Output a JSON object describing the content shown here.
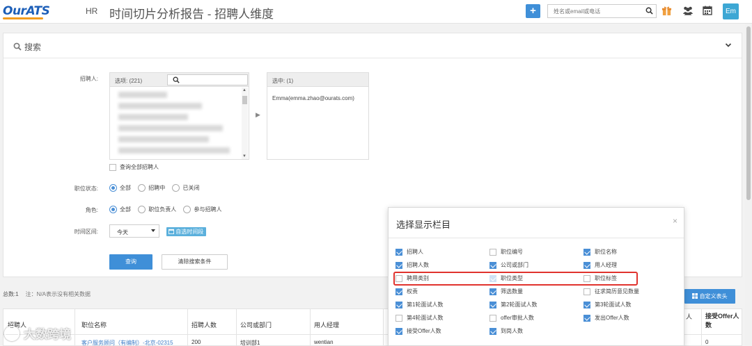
{
  "header": {
    "logo": "OurATS",
    "module": "HR",
    "title": "时间切片分析报告 - 招聘人维度",
    "add_label": "+",
    "search_placeholder": "姓名或email或电话",
    "avatar": "Em"
  },
  "search_panel": {
    "title": "搜索",
    "recruiter_label": "招聘人:",
    "options_header": "选项: (221)",
    "selected_header": "选中: (1)",
    "selected_items": [
      "Emma(emma.zhao@ourats.com)"
    ],
    "all_recruiters_label": "查询全部招聘人",
    "job_status_label": "职位状态:",
    "job_status_options": [
      "全部",
      "招聘中",
      "已关闭"
    ],
    "job_status_selected": "全部",
    "role_label": "角色:",
    "role_options": [
      "全部",
      "职位负责人",
      "参与招聘人"
    ],
    "role_selected": "全部",
    "time_range_label": "时间区间:",
    "time_range_value": "今天",
    "custom_time_label": "自选时间段",
    "search_button": "查询",
    "clear_button": "清除搜索条件"
  },
  "summary": {
    "total": "总数:1",
    "note": "注：N/A表示没有相关数据",
    "custom_header_button": "自定义表头"
  },
  "table": {
    "headers": [
      "招聘人",
      "职位名称",
      "招聘人数",
      "公司或部门",
      "用人经理",
      "人",
      "接受Offer人数"
    ],
    "row": [
      "",
      "客户服务顾问（有编制）-北京-02315",
      "200",
      "培训部1",
      "wentian",
      "",
      "0"
    ]
  },
  "column_modal": {
    "title": "选择显示栏目",
    "close": "×",
    "columns": [
      [
        {
          "label": "招聘人",
          "checked": true
        },
        {
          "label": "职位编号",
          "checked": false
        },
        {
          "label": "职位名称",
          "checked": true
        }
      ],
      [
        {
          "label": "招聘人数",
          "checked": true
        },
        {
          "label": "公司或部门",
          "checked": true
        },
        {
          "label": "用人经理",
          "checked": true
        }
      ],
      [
        {
          "label": "聘用类别",
          "checked": false
        },
        {
          "label": "职位类型",
          "checked": true
        },
        {
          "label": "职位标签",
          "checked": false
        }
      ],
      [
        {
          "label": "权责",
          "checked": true
        },
        {
          "label": "筛选数量",
          "checked": true
        },
        {
          "label": "征求简历意见数量",
          "checked": false
        }
      ],
      [
        {
          "label": "第1轮面试人数",
          "checked": true
        },
        {
          "label": "第2轮面试人数",
          "checked": true
        },
        {
          "label": "第3轮面试人数",
          "checked": true
        }
      ],
      [
        {
          "label": "第4轮面试人数",
          "checked": false
        },
        {
          "label": "offer审批人数",
          "checked": false
        },
        {
          "label": "发出Offer人数",
          "checked": true
        }
      ],
      [
        {
          "label": "接受Offer人数",
          "checked": true
        },
        {
          "label": "到岗人数",
          "checked": true
        }
      ]
    ]
  },
  "watermark": "大数跨境",
  "colors": {
    "primary": "#3f8fd8",
    "avatar": "#3da7d4",
    "highlight": "#e0322d"
  }
}
